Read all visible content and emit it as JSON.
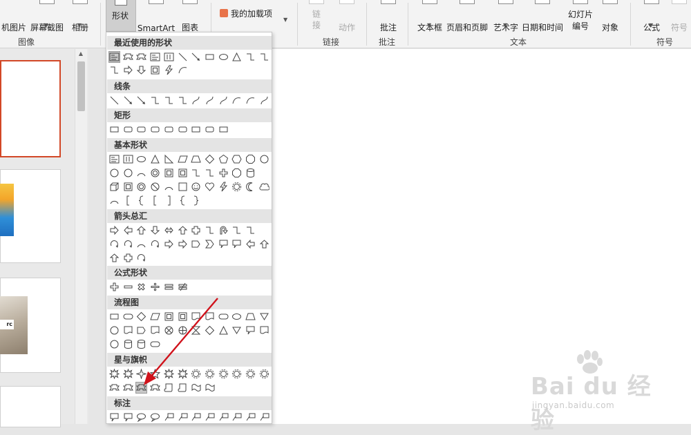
{
  "ribbon": {
    "buttons": {
      "screenshot_prefix": "机图片",
      "screen_clip": "屏幕截图",
      "album": "相册",
      "shapes": "形状",
      "smartart": "SmartArt",
      "chart": "图表",
      "my_addins": "我的加载项",
      "link": "链接",
      "action": "动作",
      "comment": "批注",
      "text_box": "文本框",
      "header_footer": "页眉和页脚",
      "wordart": "艺术字",
      "date_time": "日期和时间",
      "slide_number_1": "幻灯片",
      "slide_number_2": "编号",
      "object": "对象",
      "equation": "公式",
      "symbol": "符号"
    },
    "groups": {
      "images": "图像",
      "links": "链接",
      "comments": "批注",
      "text": "文本",
      "symbols": "符号"
    }
  },
  "shapes_menu": {
    "sections": [
      "最近使用的形状",
      "线条",
      "矩形",
      "基本形状",
      "箭头总汇",
      "公式形状",
      "流程图",
      "星与旗帜",
      "标注"
    ]
  },
  "thumb_text": "rc",
  "watermark": {
    "brand": "Bai du 经验",
    "url": "jingyan.baidu.com"
  },
  "colors": {
    "accent": "#d24726",
    "arrow": "#d0121b"
  }
}
